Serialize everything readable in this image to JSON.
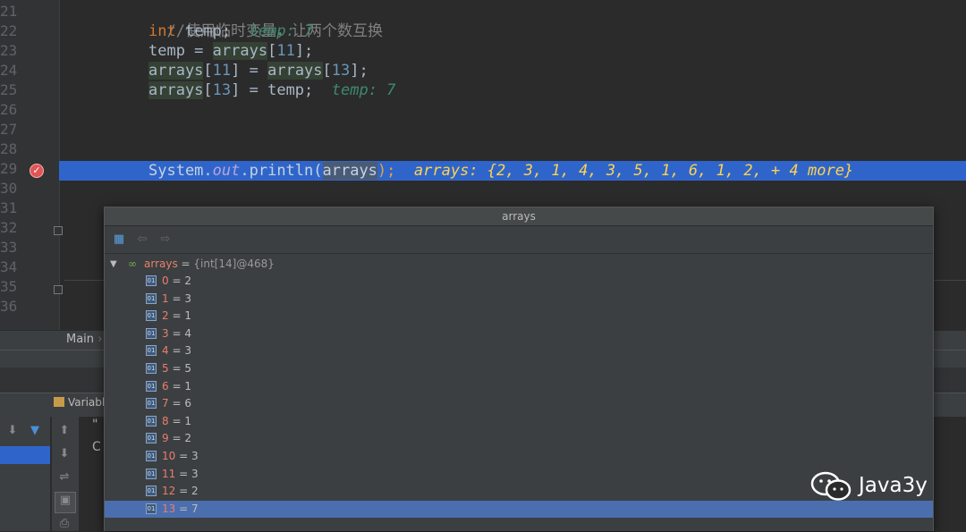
{
  "editor": {
    "line_numbers": [
      "21",
      "22",
      "23",
      "24",
      "25",
      "26",
      "27",
      "28",
      "29",
      "30",
      "31",
      "32",
      "33",
      "34",
      "35",
      "36"
    ],
    "comment": "//使用临时变量，让两个数互换",
    "line22": {
      "kw": "int",
      "rest": " temp;",
      "inline": "temp: 7"
    },
    "line23": {
      "a": "temp = ",
      "b": "arrays",
      "c": "[",
      "d": "11",
      "e": "];"
    },
    "line24": {
      "a": "arrays",
      "b": "[",
      "c": "11",
      "d": "] = ",
      "e": "arrays",
      "f": "[",
      "g": "13",
      "h": "];"
    },
    "line25": {
      "a": "arrays",
      "b": "[",
      "c": "13",
      "d": "] = temp;",
      "inline": "temp: 7"
    },
    "line29": {
      "a": "System.",
      "b": "out",
      "c": ".println(",
      "d": "arrays",
      "e": ");",
      "inline": "arrays: {2, 3, 1, 4, 3, 5, 1, 6, 1, 2, + 4 more}"
    }
  },
  "breadcrumb": {
    "label": "Main",
    "sep": "›"
  },
  "debug": {
    "variables_tab": "Variabl",
    "frame_text_1": "\"",
    "frame_text_2": "C"
  },
  "popup": {
    "title": "arrays",
    "root": {
      "name": "arrays",
      "eq": " = ",
      "type": "{int[14]@468}"
    },
    "items": [
      {
        "name": "0",
        "value": "2"
      },
      {
        "name": "1",
        "value": "3"
      },
      {
        "name": "2",
        "value": "1"
      },
      {
        "name": "3",
        "value": "4"
      },
      {
        "name": "4",
        "value": "3"
      },
      {
        "name": "5",
        "value": "5"
      },
      {
        "name": "6",
        "value": "1"
      },
      {
        "name": "7",
        "value": "6"
      },
      {
        "name": "8",
        "value": "1"
      },
      {
        "name": "9",
        "value": "2"
      },
      {
        "name": "10",
        "value": "3"
      },
      {
        "name": "11",
        "value": "3"
      },
      {
        "name": "12",
        "value": "2"
      },
      {
        "name": "13",
        "value": "7"
      }
    ],
    "int_badge": "01",
    "eq": " = "
  },
  "watermark": {
    "text": "Java3y"
  },
  "colors": {
    "accent": "#2f65ca",
    "selected_row": "#4b6eaf",
    "inline_value": "#ffd24d"
  },
  "icons": {
    "breakpoint": "breakpoint-check-icon",
    "root": "watch-variable-icon",
    "item": "int-field-icon"
  }
}
